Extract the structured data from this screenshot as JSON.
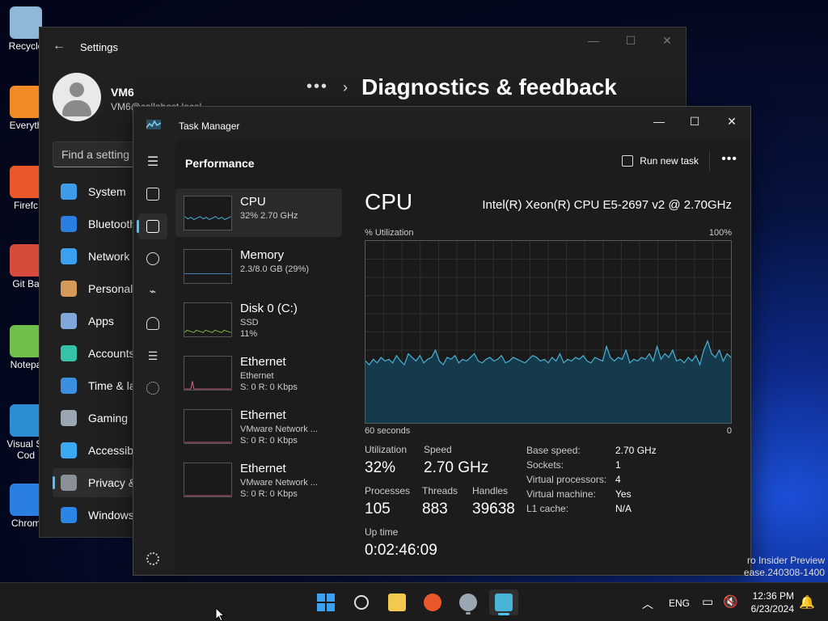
{
  "desktop": {
    "icons": [
      {
        "label": "Recycle",
        "color": "#8fb8d8"
      },
      {
        "label": "Everyth",
        "color": "#f08a24"
      },
      {
        "label": "Firefc",
        "color": "#e8582b"
      },
      {
        "label": "Git Ba",
        "color": "#d64b3b"
      },
      {
        "label": "Notepa",
        "color": "#6fbf4a"
      },
      {
        "label": "Visual St Cod",
        "color": "#2b8fd6"
      },
      {
        "label": "Chrom",
        "color": "#2a7fe0"
      }
    ],
    "watermark_line1": "ro Insider Preview",
    "watermark_line2": "ease.240308-1400"
  },
  "settings": {
    "title": "Settings",
    "user_name": "VM6",
    "user_email": "VM6@callahost.local",
    "breadcrumb_dots": "•••",
    "breadcrumb_chevron": "›",
    "page_title": "Diagnostics & feedback",
    "search_placeholder": "Find a setting",
    "nav": [
      {
        "label": "System",
        "icon": "system-icon",
        "color": "#3d9be9"
      },
      {
        "label": "Bluetooth",
        "icon": "bluetooth-icon",
        "color": "#2a7ee0"
      },
      {
        "label": "Network",
        "icon": "network-icon",
        "color": "#3aa0f2"
      },
      {
        "label": "Personali",
        "icon": "brush-icon",
        "color": "#d59a5a"
      },
      {
        "label": "Apps",
        "icon": "apps-icon",
        "color": "#7fa7d8"
      },
      {
        "label": "Accounts",
        "icon": "accounts-icon",
        "color": "#36c2a8"
      },
      {
        "label": "Time & la",
        "icon": "clock-icon",
        "color": "#3c8fe0"
      },
      {
        "label": "Gaming",
        "icon": "gamepad-icon",
        "color": "#9aa6b2"
      },
      {
        "label": "Accessibi",
        "icon": "accessibility-icon",
        "color": "#3aa8f2"
      },
      {
        "label": "Privacy &",
        "icon": "shield-icon",
        "color": "#8a8f98"
      },
      {
        "label": "Windows",
        "icon": "update-icon",
        "color": "#2a86e6"
      }
    ],
    "active_nav_index": 9
  },
  "task_manager": {
    "title": "Task Manager",
    "section_title": "Performance",
    "run_new_task": "Run new task",
    "more": "•••",
    "resources": [
      {
        "name": "CPU",
        "line1": "32% 2.70 GHz",
        "line2": "",
        "color": "#4ab3d8"
      },
      {
        "name": "Memory",
        "line1": "2.3/8.0 GB (29%)",
        "line2": "",
        "color": "#4a8fd8"
      },
      {
        "name": "Disk 0 (C:)",
        "line1": "SSD",
        "line2": "11%",
        "color": "#7fbf3f"
      },
      {
        "name": "Ethernet",
        "line1": "Ethernet",
        "line2": "S: 0 R: 0 Kbps",
        "color": "#d86a8a"
      },
      {
        "name": "Ethernet",
        "line1": "VMware Network ...",
        "line2": "S: 0 R: 0 Kbps",
        "color": "#d86a8a"
      },
      {
        "name": "Ethernet",
        "line1": "VMware Network ...",
        "line2": "S: 0 R: 0 Kbps",
        "color": "#d86a8a"
      }
    ],
    "detail": {
      "title": "CPU",
      "model": "Intel(R) Xeon(R) CPU E5-2697 v2 @ 2.70GHz",
      "util_label": "% Utilization",
      "util_max": "100%",
      "axis_left": "60 seconds",
      "axis_right": "0",
      "stats": {
        "utilization_label": "Utilization",
        "utilization": "32%",
        "speed_label": "Speed",
        "speed": "2.70 GHz",
        "processes_label": "Processes",
        "processes": "105",
        "threads_label": "Threads",
        "threads": "883",
        "handles_label": "Handles",
        "handles": "39638",
        "uptime_label": "Up time",
        "uptime": "0:02:46:09"
      },
      "specs": [
        {
          "key": "Base speed:",
          "value": "2.70 GHz"
        },
        {
          "key": "Sockets:",
          "value": "1"
        },
        {
          "key": "Virtual processors:",
          "value": "4"
        },
        {
          "key": "Virtual machine:",
          "value": "Yes"
        },
        {
          "key": "L1 cache:",
          "value": "N/A"
        }
      ],
      "graph_series": [
        34,
        32,
        35,
        33,
        36,
        34,
        35,
        33,
        37,
        34,
        32,
        38,
        36,
        34,
        37,
        33,
        35,
        36,
        40,
        34,
        32,
        36,
        35,
        37,
        33,
        35,
        34,
        36,
        38,
        34,
        33,
        35,
        36,
        34,
        35,
        37,
        33,
        34,
        36,
        35,
        34,
        33,
        35,
        37,
        36,
        34,
        35,
        33,
        36,
        34,
        38,
        33,
        35,
        34,
        36,
        35,
        37,
        34,
        33,
        36,
        35,
        34,
        42,
        36,
        34,
        36,
        35,
        40,
        33,
        35,
        34,
        36,
        35,
        38,
        34,
        42,
        35,
        38,
        36,
        40,
        34,
        35,
        33,
        36,
        34,
        37,
        32,
        40,
        45,
        38,
        36,
        40,
        34,
        38,
        36
      ]
    }
  },
  "taskbar": {
    "apps": [
      {
        "name": "start-icon",
        "color": "#3aa0f2"
      },
      {
        "name": "search-icon",
        "color": "#e0e0e0"
      },
      {
        "name": "file-explorer-icon",
        "color": "#f2c94c"
      },
      {
        "name": "firefox-icon",
        "color": "#e8582b"
      },
      {
        "name": "settings-icon",
        "color": "#9aa6b2"
      },
      {
        "name": "task-manager-icon",
        "color": "#4ab3d8"
      }
    ],
    "language": "ENG",
    "time": "12:36 PM",
    "date": "6/23/2024"
  }
}
